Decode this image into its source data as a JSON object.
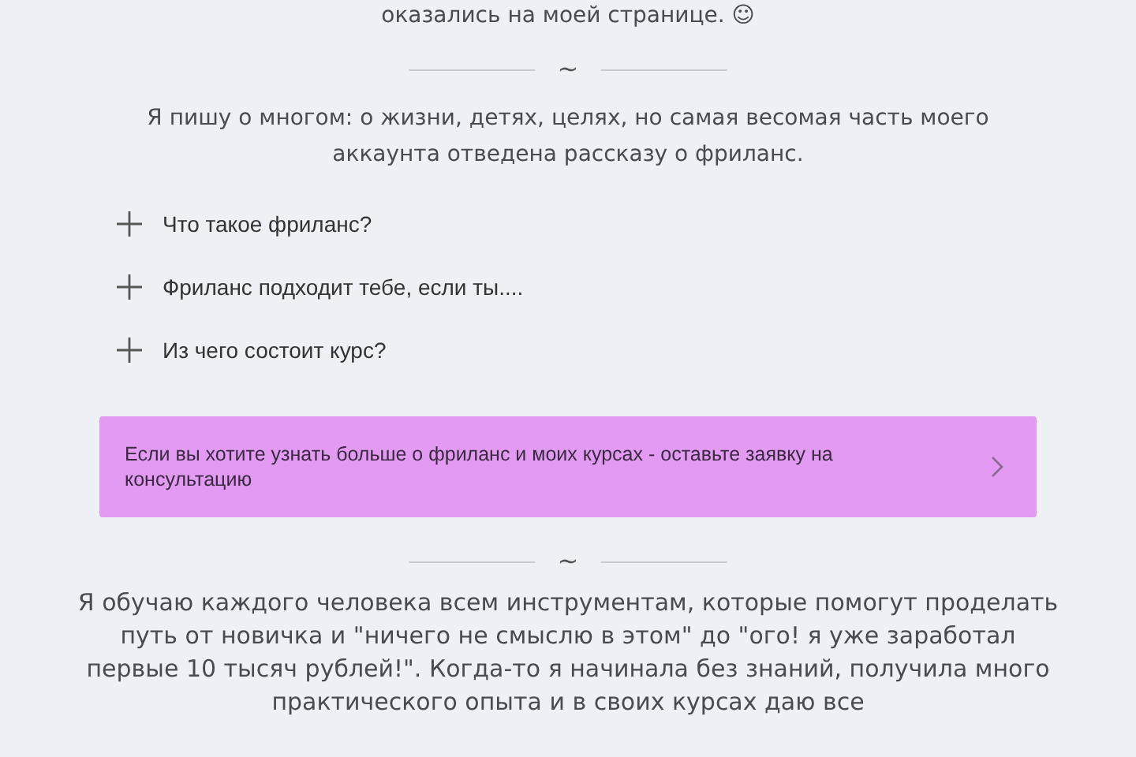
{
  "intro_line": "оказались на моей странице. ☺",
  "divider_1": {
    "symbol": "~"
  },
  "about_text": "Я пишу о многом: о жизни, детях, целях, но самая весомая часть моего аккаунта отведена рассказу о фриланс.",
  "accordion": [
    {
      "label": "Что такое фриланс?",
      "expanded": false
    },
    {
      "label": "Фриланс подходит тебе, если ты....",
      "expanded": false
    },
    {
      "label": "Из чего состоит курс?",
      "expanded": false
    }
  ],
  "banner": {
    "text": "Если вы хотите узнать больше о фриланс и моих курсах - оставьте заявку на консультацию"
  },
  "divider_2": {
    "symbol": "~"
  },
  "teaching_text": "Я обучаю каждого человека всем инструментам, которые помогут проделать путь от новичка и \"ничего не смыслю в этом\" до \"ого! я уже заработал первые 10 тысяч рублей!\". Когда-то я начинала без знаний, получила много практического опыта и в своих курсах даю все"
}
